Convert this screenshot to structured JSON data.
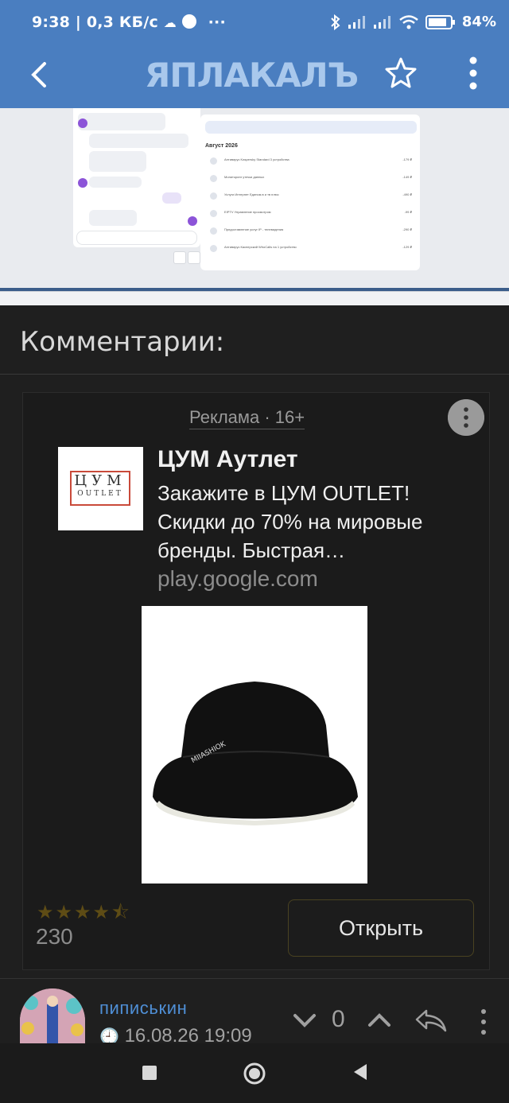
{
  "statusbar": {
    "time": "9:38 | 0,3 КБ/с",
    "extra": "···",
    "battery": "84"
  },
  "appbar": {
    "logo": "ЯПЛАКАЛЪ"
  },
  "screenshot": {
    "month_heading": "Август 2026",
    "rows": [
      {
        "title": "Антивирус Kaspersky Standard 3 устройства",
        "amount": "-179 ₽"
      },
      {
        "title": "Мониторинг утечки данных",
        "amount": "-149 ₽"
      },
      {
        "title": "Услуги Интернет Едином.в и тв плюс",
        "amount": "-490 ₽"
      },
      {
        "title": "EIPTV Управление просмотром",
        "amount": "-99 ₽"
      },
      {
        "title": "Предоставление услуг IP - телевидения",
        "amount": "-290 ₽"
      },
      {
        "title": "Антивирус Касперский WhoCalls на 1 устройство",
        "amount": "-129 ₽"
      }
    ]
  },
  "comments": {
    "heading": "Комментарии:"
  },
  "ad": {
    "label": "Реклама · 16+",
    "brand_line1": "ЦУМ",
    "brand_line2": "OUTLET",
    "title": "ЦУМ Аутлет",
    "description": "Закажите в ЦУМ OUTLET! Скидки до 70% на мировые бренды. Быстрая…",
    "domain": "play.google.com",
    "rating": 4.5,
    "rating_count": "230",
    "open_button": "Открыть"
  },
  "comment": {
    "username": "пиписькин",
    "timestamp": "16.08.26 19:09",
    "votes": "0"
  },
  "colors": {
    "header": "#4a7ec0",
    "background": "#1f1f1f",
    "username": "#4f8fd6",
    "star": "#5e4c15"
  }
}
